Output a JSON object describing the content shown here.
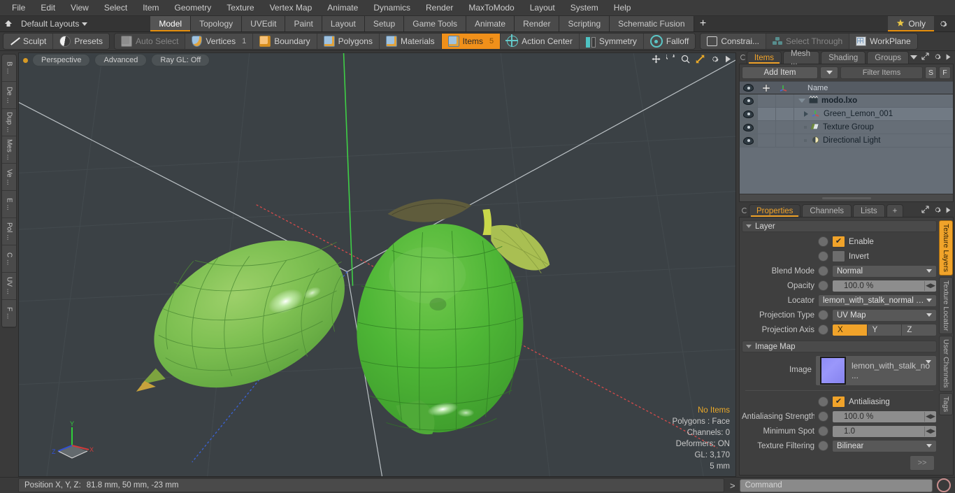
{
  "menu": {
    "items": [
      "File",
      "Edit",
      "View",
      "Select",
      "Item",
      "Geometry",
      "Texture",
      "Vertex Map",
      "Animate",
      "Dynamics",
      "Render",
      "MaxToModo",
      "Layout",
      "System",
      "Help"
    ]
  },
  "layoutbar": {
    "layout_label": "Default Layouts",
    "tabs": [
      "Model",
      "Topology",
      "UVEdit",
      "Paint",
      "Layout",
      "Setup",
      "Game Tools",
      "Animate",
      "Render",
      "Scripting",
      "Schematic Fusion"
    ],
    "active_tab": "Model",
    "plus_label": "+",
    "only_label": "Only"
  },
  "toolbar": {
    "group1": [
      {
        "label": "Sculpt",
        "icon": "pencil-icon",
        "state": "normal"
      },
      {
        "label": "Presets",
        "icon": "sphere-icon",
        "state": "normal"
      }
    ],
    "group2": [
      {
        "label": "Auto Select",
        "icon": "cube-icon",
        "state": "dim",
        "count": ""
      },
      {
        "label": "Vertices",
        "icon": "shield-icon",
        "state": "normal",
        "count": "1"
      },
      {
        "label": "Boundary",
        "icon": "boundary-icon",
        "state": "normal",
        "count": ""
      },
      {
        "label": "Polygons",
        "icon": "cube-icon",
        "state": "normal",
        "count": ""
      },
      {
        "label": "Materials",
        "icon": "cube-icon",
        "state": "normal",
        "count": ""
      },
      {
        "label": "Items",
        "icon": "cube-icon",
        "state": "selected",
        "count": "5"
      },
      {
        "label": "Action Center",
        "icon": "target-icon",
        "state": "normal",
        "count": ""
      },
      {
        "label": "Symmetry",
        "icon": "symmetry-icon",
        "state": "normal",
        "count": ""
      },
      {
        "label": "Falloff",
        "icon": "falloff-icon",
        "state": "normal",
        "count": ""
      }
    ],
    "group3": [
      {
        "label": "Constrai...",
        "icon": "square-icon",
        "state": "normal"
      },
      {
        "label": "Select Through",
        "icon": "select-through-icon",
        "state": "dim"
      },
      {
        "label": "WorkPlane",
        "icon": "workplane-icon",
        "state": "normal"
      }
    ]
  },
  "leftrail": {
    "tabs": [
      "B ...",
      "De ...",
      "Dup ...",
      "Mes ...",
      "Ve ...",
      "E ...",
      "Pol ...",
      "C ...",
      "UV ...",
      "F ..."
    ]
  },
  "viewport": {
    "pills": [
      "Perspective",
      "Advanced",
      "Ray GL: Off"
    ],
    "icons": [
      "move-icon",
      "rotate-icon",
      "zoom-icon",
      "fit-icon",
      "gear-icon",
      "play-icon"
    ],
    "stats": [
      {
        "text": "No Items",
        "highlight": true
      },
      {
        "text": "Polygons : Face",
        "highlight": false
      },
      {
        "text": "Channels: 0",
        "highlight": false
      },
      {
        "text": "Deformers: ON",
        "highlight": false
      },
      {
        "text": "GL: 3,170",
        "highlight": false
      },
      {
        "text": "5 mm",
        "highlight": false
      }
    ],
    "gizmo_axes": [
      "Y",
      "X",
      "Z"
    ]
  },
  "statusbar": {
    "position_label": "Position X, Y, Z:",
    "position_value": "81.8 mm, 50 mm, -23 mm",
    "command_prompt": ">",
    "command_placeholder": "Command"
  },
  "items_panel": {
    "tabs": [
      "Items",
      "Mesh ...",
      "Shading",
      "Groups"
    ],
    "active_tab": "Items",
    "add_item_label": "Add Item",
    "filter_placeholder": "Filter Items",
    "btn_s": "S",
    "btn_f": "F",
    "columns": [
      "eye-column",
      "add-column",
      "axis-column",
      "Name"
    ],
    "name_column_header": "Name",
    "rows": [
      {
        "name": "modo.lxo",
        "icon": "scene-icon",
        "indent": 0,
        "expander": "down",
        "bold": true,
        "selected": false
      },
      {
        "name": "Green_Lemon_001",
        "icon": "mesh-axis-icon",
        "indent": 1,
        "expander": "right",
        "bold": false,
        "selected": true
      },
      {
        "name": "Texture Group",
        "icon": "texture-group-icon",
        "indent": 1,
        "expander": "none",
        "bold": false,
        "selected": false
      },
      {
        "name": "Directional Light",
        "icon": "light-icon",
        "indent": 1,
        "expander": "none",
        "bold": false,
        "selected": false
      }
    ]
  },
  "properties_panel": {
    "tabs": [
      "Properties",
      "Channels",
      "Lists"
    ],
    "active_tab": "Properties",
    "plus_label": "+",
    "layer_section": {
      "title": "Layer",
      "enable": {
        "label": "Enable",
        "checked": true
      },
      "invert": {
        "label": "Invert",
        "checked": false
      },
      "blend_mode": {
        "label": "Blend Mode",
        "value": "Normal"
      },
      "opacity": {
        "label": "Opacity",
        "value": "100.0 %"
      },
      "locator": {
        "label": "Locator",
        "value": "lemon_with_stalk_normal (Im ..."
      },
      "projection_type": {
        "label": "Projection Type",
        "value": "UV Map"
      },
      "projection_axis": {
        "label": "Projection Axis",
        "options": [
          "X",
          "Y",
          "Z"
        ],
        "selected": "X"
      }
    },
    "image_map_section": {
      "title": "Image Map",
      "image": {
        "label": "Image",
        "value": "lemon_with_stalk_no ...",
        "swatch_color": "#8e8cf7"
      },
      "antialiasing": {
        "label": "Antialiasing",
        "checked": true
      },
      "antialiasing_strength": {
        "label": "Antialiasing Strength",
        "value": "100.0 %"
      },
      "minimum_spot": {
        "label": "Minimum Spot",
        "value": "1.0"
      },
      "texture_filtering": {
        "label": "Texture Filtering",
        "value": "Bilinear"
      },
      "more_button": ">>"
    },
    "side_tabs": [
      "Texture Layers",
      "Texture Locator",
      "User Channels",
      "Tags"
    ],
    "active_side_tab": "Texture Layers"
  },
  "colors": {
    "accent": "#f0a32a",
    "viewport_bg": "#3b4145",
    "lemon_green": "#5fb647",
    "leaf_dark": "#5d5a3a",
    "panel_bg": "#3f3f3f"
  }
}
